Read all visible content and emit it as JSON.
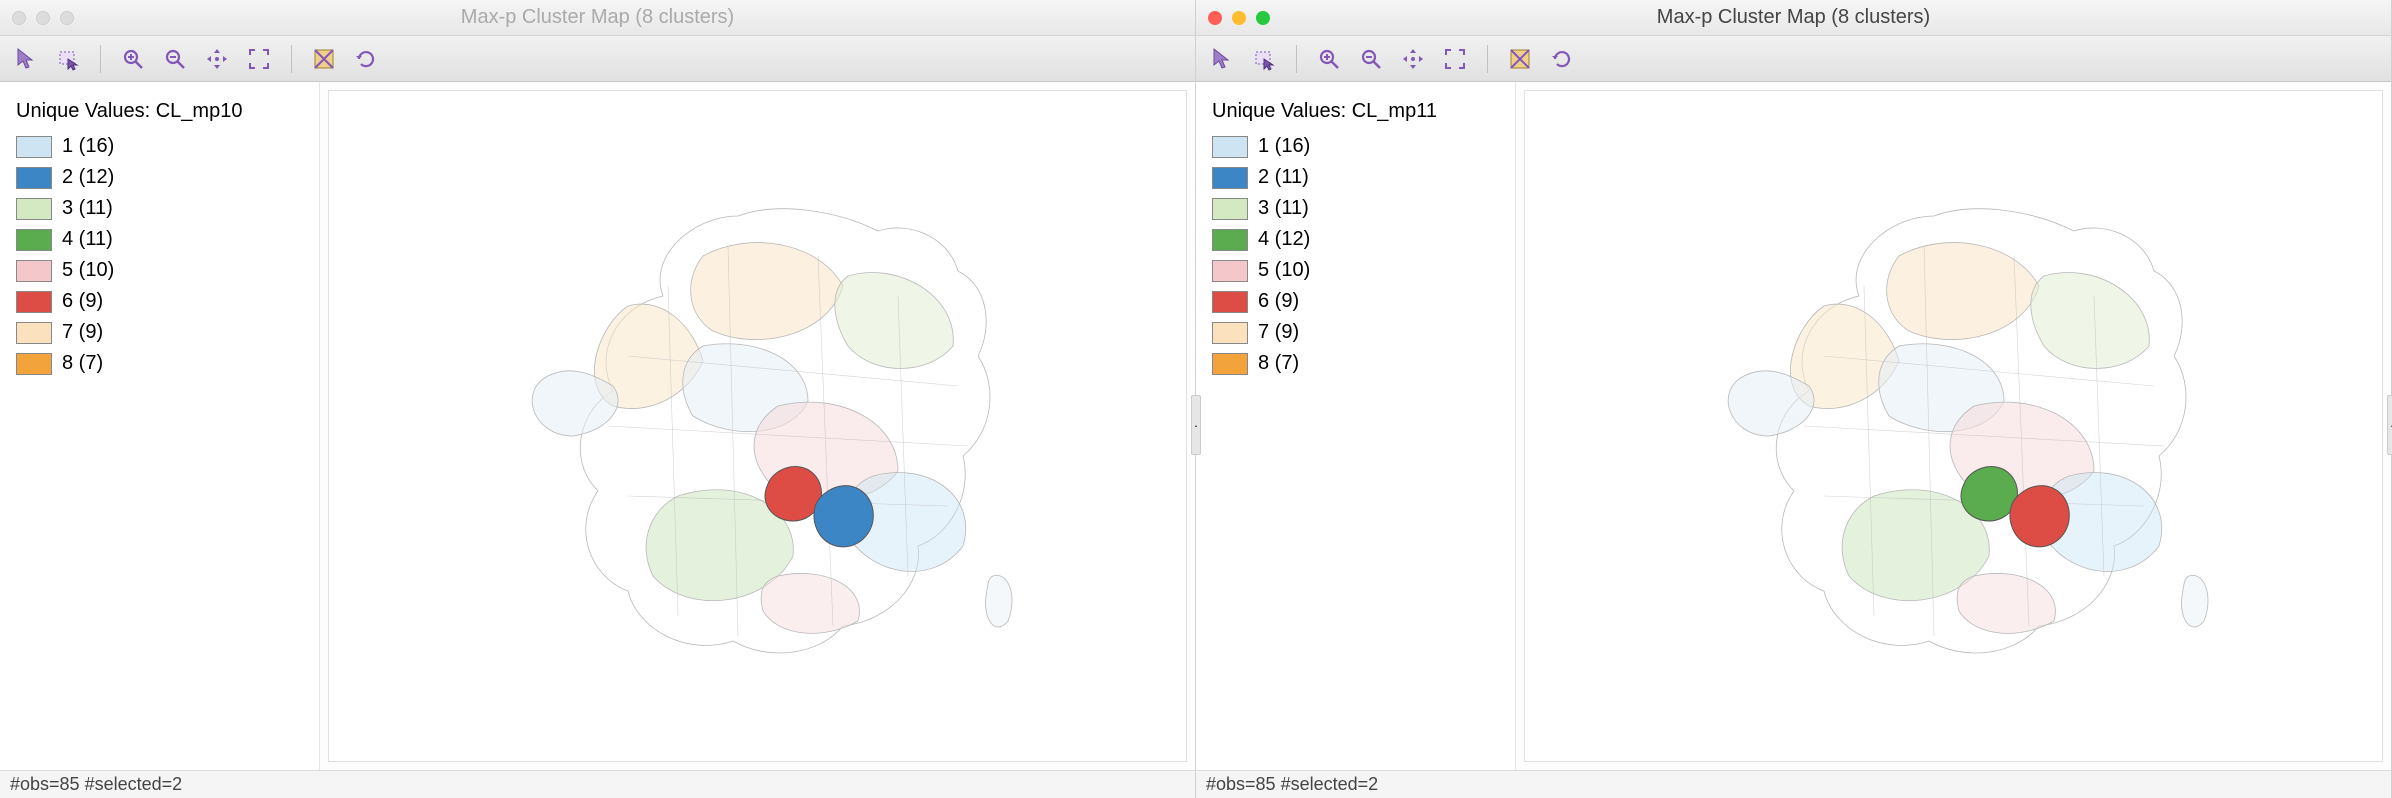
{
  "windows": [
    {
      "active": false,
      "title": "Max-p Cluster Map (8 clusters)",
      "legend_title": "Unique Values: CL_mp10",
      "legend": [
        {
          "color": "#cfe4f2",
          "label": "1 (16)"
        },
        {
          "color": "#3d86c6",
          "label": "2 (12)"
        },
        {
          "color": "#d4e8c2",
          "label": "3 (11)"
        },
        {
          "color": "#5bab4f",
          "label": "4 (11)"
        },
        {
          "color": "#f4c7cb",
          "label": "5 (10)"
        },
        {
          "color": "#de4d45",
          "label": "6 (9)"
        },
        {
          "color": "#fbe1bd",
          "label": "7 (9)"
        },
        {
          "color": "#f2a33c",
          "label": "8 (7)"
        }
      ],
      "highlight": [
        {
          "shape": "left",
          "color": "#de4d45"
        },
        {
          "shape": "right",
          "color": "#3d86c6"
        }
      ],
      "status": "#obs=85 #selected=2"
    },
    {
      "active": true,
      "title": "Max-p Cluster Map (8 clusters)",
      "legend_title": "Unique Values: CL_mp11",
      "legend": [
        {
          "color": "#cfe4f2",
          "label": "1 (16)"
        },
        {
          "color": "#3d86c6",
          "label": "2 (11)"
        },
        {
          "color": "#d4e8c2",
          "label": "3 (11)"
        },
        {
          "color": "#5bab4f",
          "label": "4 (12)"
        },
        {
          "color": "#f4c7cb",
          "label": "5 (10)"
        },
        {
          "color": "#de4d45",
          "label": "6 (9)"
        },
        {
          "color": "#fbe1bd",
          "label": "7 (9)"
        },
        {
          "color": "#f2a33c",
          "label": "8 (7)"
        }
      ],
      "highlight": [
        {
          "shape": "left",
          "color": "#5bab4f"
        },
        {
          "shape": "right",
          "color": "#de4d45"
        }
      ],
      "status": "#obs=85 #selected=2"
    }
  ],
  "map_palette": {
    "c1": "#e3eef6",
    "c2": "#c9e4f5",
    "c3": "#e2efd6",
    "c4": "#c4e0b1",
    "c5": "#f6dee0",
    "c7": "#fae7cb",
    "stroke": "#b8b8b8"
  },
  "toolbar_icons": [
    "pointer",
    "select-rect",
    "zoom-in",
    "zoom-out",
    "pan",
    "zoom-extent",
    "toggle-map",
    "refresh"
  ]
}
